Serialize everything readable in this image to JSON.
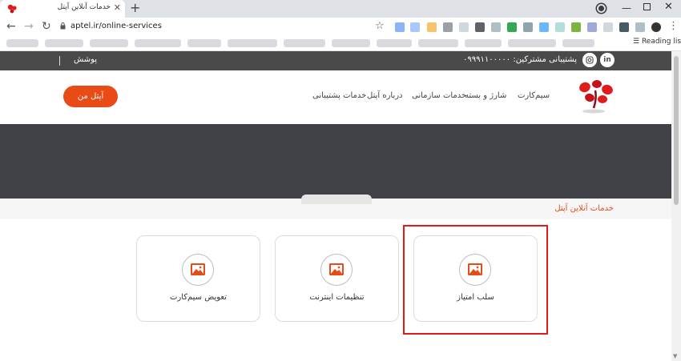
{
  "browser": {
    "tab_title": "خدمات آنلاین آپتل",
    "tab_close": "✕",
    "new_tab": "+",
    "url": "aptel.ir/online-services",
    "nav_back": "←",
    "nav_forward": "→",
    "nav_reload": "↻",
    "star": "☆",
    "menu": "⋮",
    "window_min": "—",
    "window_close": "✕",
    "reading_list": "Reading list"
  },
  "site": {
    "topbar": {
      "support": "پشتیبانی مشترکین: ۰۹۹۹۱۱۰۰۰۰۰",
      "login": "پوشش",
      "linkedin": "in"
    },
    "nav": {
      "items": [
        "سیم‌کارت",
        "شارژ و بسته",
        "خدمات سازمانی",
        "درباره آپتل",
        "خدمات پشتیبانی"
      ]
    },
    "cta_button": "آپتل من",
    "section_title": "خدمات آنلاین آپتل",
    "cards": [
      {
        "label": "سلب امتیاز"
      },
      {
        "label": "تنظیمات اینترنت"
      },
      {
        "label": "تعویض سیم‌کارت"
      }
    ]
  },
  "colors": {
    "accent": "#e84b16",
    "highlight": "#e01b1b",
    "topbar": "#4a4a4a",
    "hero": "#3f4146"
  }
}
